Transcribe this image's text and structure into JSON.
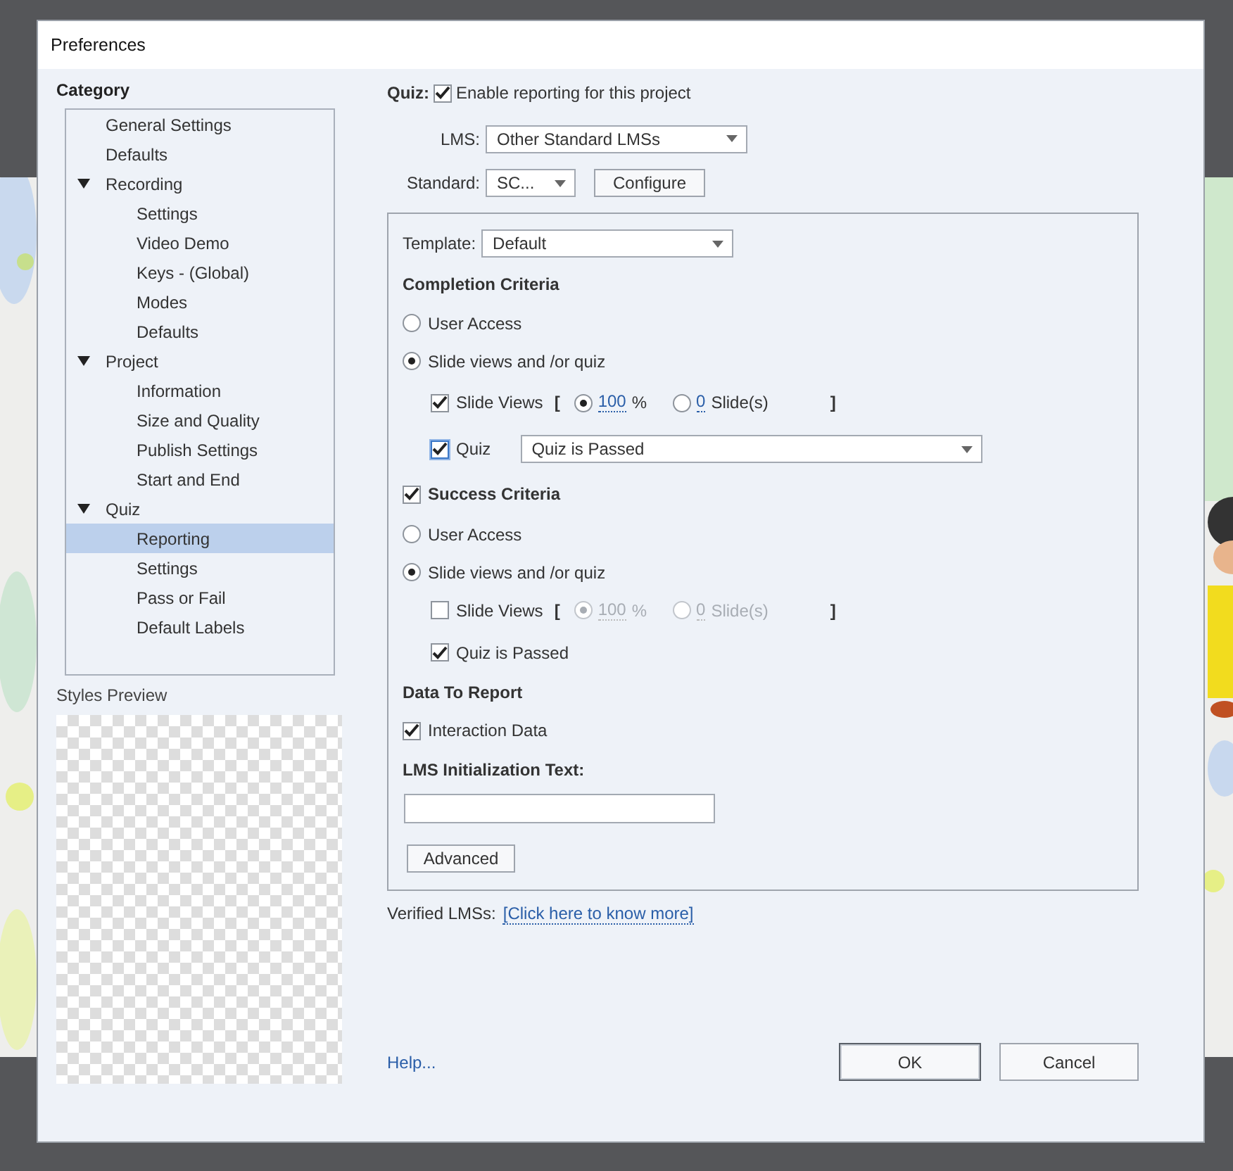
{
  "window": {
    "title": "Preferences"
  },
  "sidebar": {
    "heading": "Category",
    "items": [
      {
        "label": "General Settings",
        "selected": false
      },
      {
        "label": "Defaults",
        "selected": false
      },
      {
        "label": "Recording",
        "selected": false,
        "expanded": true,
        "children": [
          {
            "label": "Settings",
            "selected": false
          },
          {
            "label": "Video Demo",
            "selected": false
          },
          {
            "label": "Keys - (Global)",
            "selected": false
          },
          {
            "label": "Modes",
            "selected": false
          },
          {
            "label": "Defaults",
            "selected": false
          }
        ]
      },
      {
        "label": "Project",
        "selected": false,
        "expanded": true,
        "children": [
          {
            "label": "Information",
            "selected": false
          },
          {
            "label": "Size and Quality",
            "selected": false
          },
          {
            "label": "Publish Settings",
            "selected": false
          },
          {
            "label": "Start and End",
            "selected": false
          }
        ]
      },
      {
        "label": "Quiz",
        "selected": false,
        "expanded": true,
        "children": [
          {
            "label": "Reporting",
            "selected": true
          },
          {
            "label": "Settings",
            "selected": false
          },
          {
            "label": "Pass or Fail",
            "selected": false
          },
          {
            "label": "Default Labels",
            "selected": false
          }
        ]
      }
    ]
  },
  "preview": {
    "label": "Styles Preview"
  },
  "quiz": {
    "label": "Quiz:",
    "enable": {
      "label": "Enable reporting for this project",
      "checked": true
    }
  },
  "lms": {
    "label": "LMS:",
    "value": "Other Standard LMSs"
  },
  "standard": {
    "label": "Standard:",
    "value": "SC...",
    "button": "Configure"
  },
  "template": {
    "label": "Template:",
    "value": "Default"
  },
  "completion": {
    "heading": "Completion Criteria",
    "options": [
      {
        "label": "User Access",
        "selected": false
      },
      {
        "label": "Slide views and /or quiz",
        "selected": true
      }
    ],
    "slide_views": {
      "label": "Slide Views",
      "checked": true,
      "disabled": false,
      "open": "[",
      "close": "]",
      "choices": [
        {
          "value": "100",
          "unit": "%",
          "selected": true
        },
        {
          "value": "0",
          "unit": "Slide(s)",
          "selected": false
        }
      ]
    },
    "quiz": {
      "label": "Quiz",
      "checked": true,
      "focused": true,
      "value": "Quiz is Passed"
    }
  },
  "success": {
    "label": "Success Criteria",
    "checked": true,
    "options": [
      {
        "label": "User Access",
        "selected": false
      },
      {
        "label": "Slide views and /or quiz",
        "selected": true
      }
    ],
    "slide_views": {
      "label": "Slide Views",
      "checked": false,
      "disabled": true,
      "open": "[",
      "close": "]",
      "choices": [
        {
          "value": "100",
          "unit": "%",
          "selected": true
        },
        {
          "value": "0",
          "unit": "Slide(s)",
          "selected": false
        }
      ]
    },
    "quiz_passed": {
      "label": "Quiz is Passed",
      "checked": true
    }
  },
  "data_to_report": {
    "heading": "Data To Report",
    "interaction": {
      "label": "Interaction Data",
      "checked": true
    }
  },
  "init_text": {
    "label": "LMS Initialization Text:"
  },
  "advanced_button": "Advanced",
  "verified": {
    "label": "Verified LMSs:",
    "link": "[Click here to know more]"
  },
  "help_link": "Help...",
  "buttons": [
    {
      "label": "OK",
      "default": true
    },
    {
      "label": "Cancel",
      "default": false
    }
  ]
}
